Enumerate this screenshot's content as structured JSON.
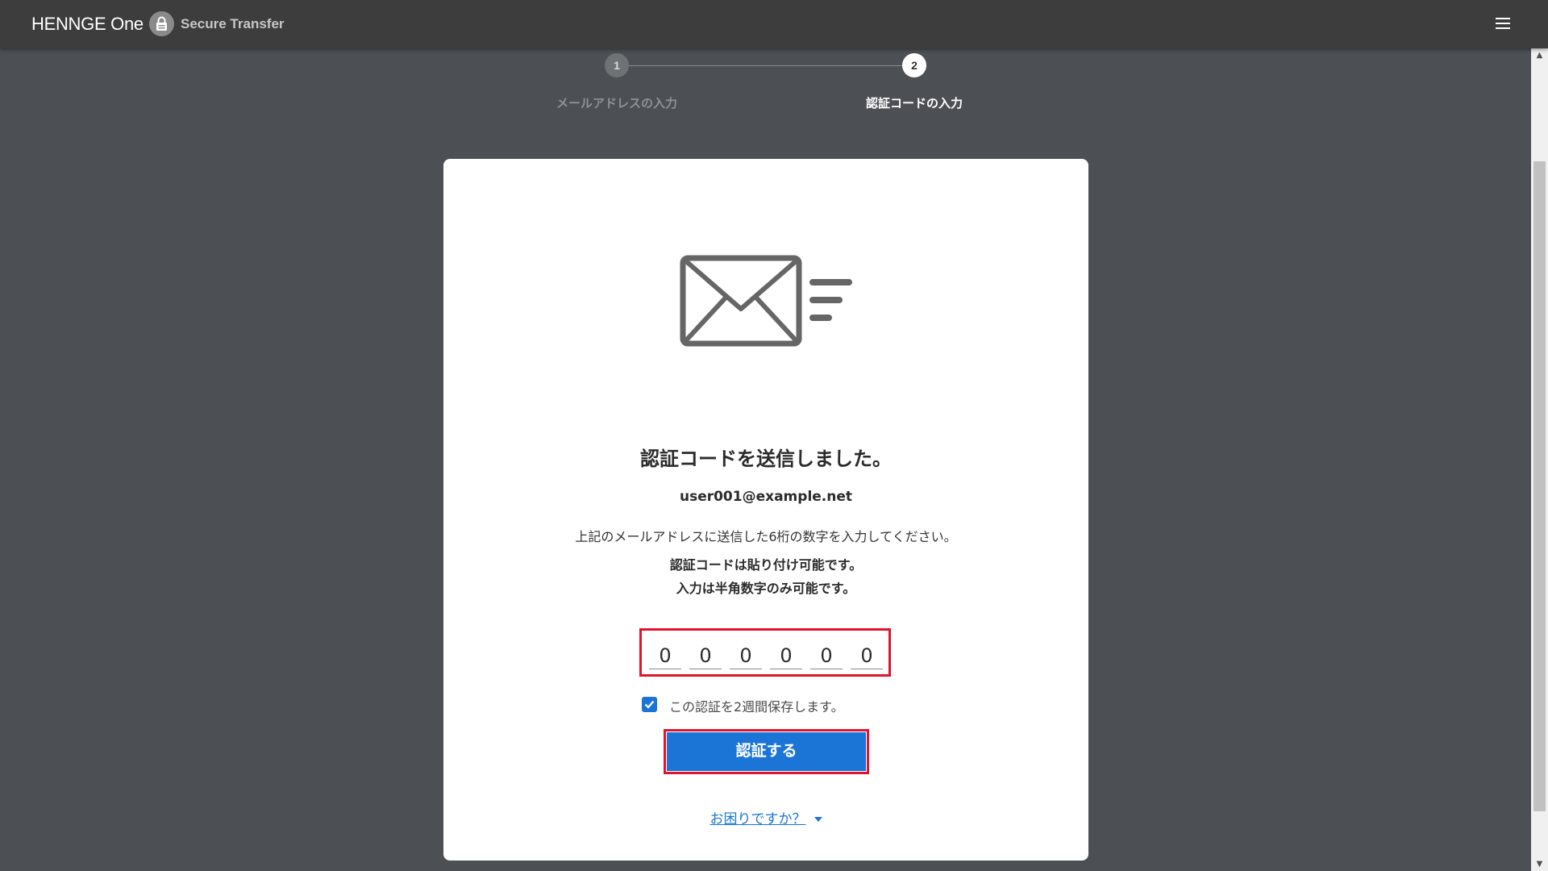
{
  "header": {
    "brand": "HENNGE One",
    "product": "Secure Transfer",
    "logo_icon": "lock-icon",
    "menu_icon": "hamburger-menu-icon"
  },
  "stepper": {
    "steps": [
      {
        "number": "1",
        "label": "メールアドレスの入力",
        "state": "completed"
      },
      {
        "number": "2",
        "label": "認証コードの入力",
        "state": "active"
      }
    ]
  },
  "card": {
    "illustration_icon": "mail-sent-icon",
    "title": "認証コードを送信しました。",
    "email": "user001@example.net",
    "instruction": "上記のメールアドレスに送信した6桁の数字を入力してください。",
    "note_paste": "認証コードは貼り付け可能です。",
    "note_digits": "入力は半角数字のみ可能です。",
    "code_digits": [
      "0",
      "0",
      "0",
      "0",
      "0",
      "0"
    ],
    "remember": {
      "checked": true,
      "label": "この認証を2週間保存します。"
    },
    "submit_label": "認証する",
    "help_label": "お困りですか？"
  },
  "colors": {
    "background": "#4c5054",
    "topbar": "#3d3d3d",
    "accent": "#1b75d6",
    "highlight": "#e0142c"
  }
}
